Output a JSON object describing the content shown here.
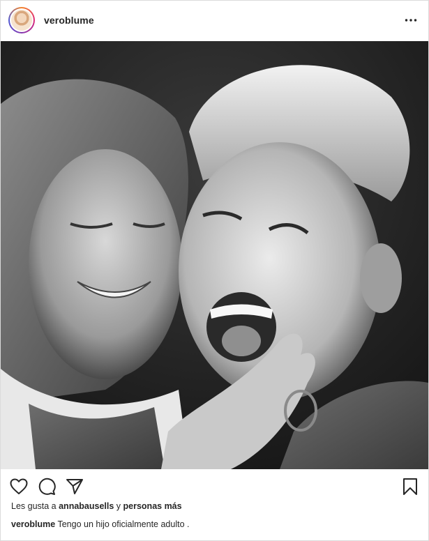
{
  "post": {
    "username": "veroblume",
    "more_icon": "more-horizontal-icon",
    "photo_description_icon": "photo",
    "actions": {
      "like_icon": "heart-icon",
      "comment_icon": "comment-icon",
      "share_icon": "paper-plane-icon",
      "save_icon": "bookmark-icon"
    },
    "likes": {
      "prefix": "Les gusta a ",
      "user": "annabausells",
      "middle": " y ",
      "others": "personas más"
    },
    "caption": {
      "username": "veroblume",
      "text": " Tengo un hijo oficialmente adulto ."
    }
  }
}
